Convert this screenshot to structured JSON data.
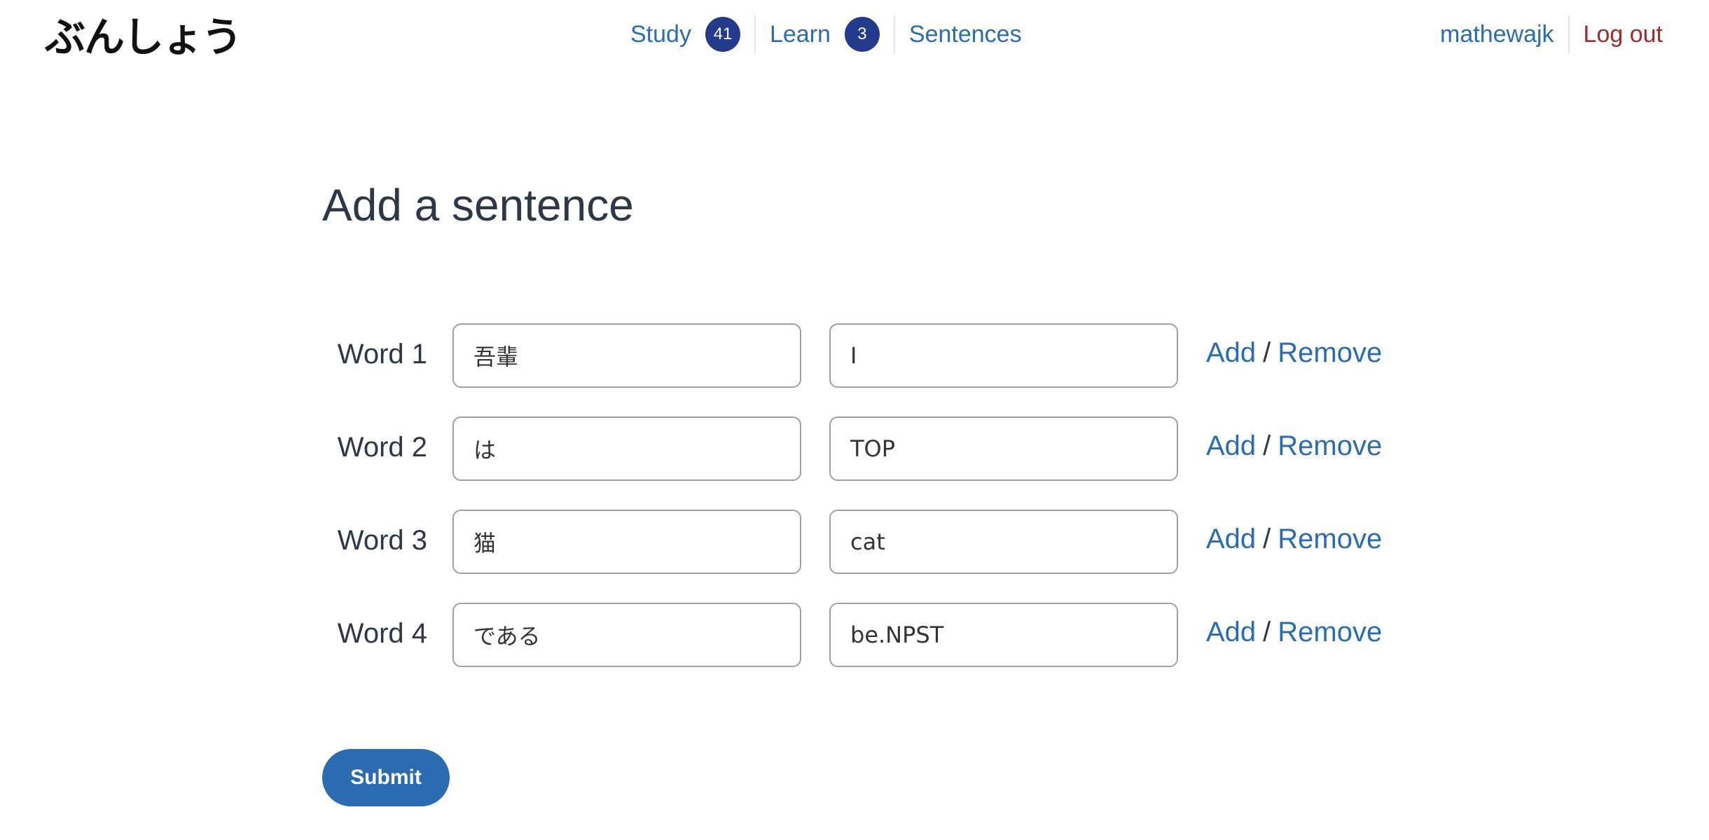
{
  "app": {
    "logo_text": "ぶんしょう"
  },
  "nav": {
    "study": {
      "label": "Study",
      "count": "41"
    },
    "learn": {
      "label": "Learn",
      "count": "3"
    },
    "sentences": {
      "label": "Sentences"
    }
  },
  "user": {
    "username": "mathewajk",
    "logout_label": "Log out"
  },
  "page": {
    "title": "Add a sentence"
  },
  "words": [
    {
      "label": "Word 1",
      "japanese": "吾輩",
      "gloss": "I",
      "add_label": "Add",
      "separator": "/",
      "remove_label": "Remove"
    },
    {
      "label": "Word 2",
      "japanese": "は",
      "gloss": "TOP",
      "add_label": "Add",
      "separator": "/",
      "remove_label": "Remove"
    },
    {
      "label": "Word 3",
      "japanese": "猫",
      "gloss": "cat",
      "add_label": "Add",
      "separator": "/",
      "remove_label": "Remove"
    },
    {
      "label": "Word 4",
      "japanese": "である",
      "gloss": "be.NPST",
      "add_label": "Add",
      "separator": "/",
      "remove_label": "Remove"
    }
  ],
  "form": {
    "submit_label": "Submit"
  },
  "colors": {
    "link": "#2b6cb0",
    "badge": "#233b8a",
    "logout": "#9b2c2c",
    "submit": "#2b6cb0"
  }
}
